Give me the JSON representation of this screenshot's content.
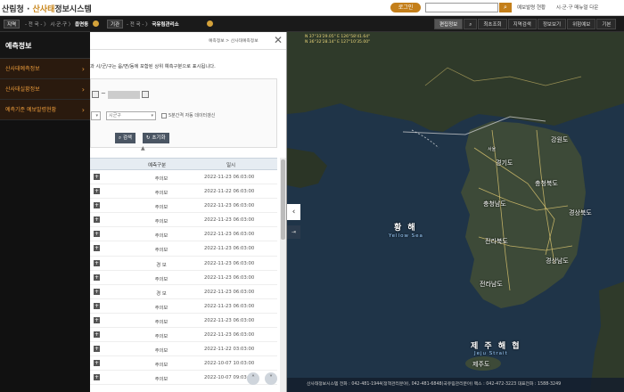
{
  "header": {
    "logo_pre": "산림청",
    "logo_accent": "산사태",
    "logo_post": "정보시스템",
    "login": "로그인",
    "links": [
      "예보발령 현황",
      "시·군·구 매뉴얼 다운"
    ]
  },
  "locbar": {
    "label1": "지역",
    "path1": "- 전 국 - 〉 시·군·구 〉",
    "current1": "읍면동",
    "label2": "기관",
    "path2": "- 전 국 - 〉",
    "current2": "국유림관리소",
    "tools": [
      "편집정보",
      "최초조회",
      "지역검색",
      "정보보기",
      "위험예보",
      "기본"
    ]
  },
  "leftnav": {
    "title": "예측정보",
    "items": [
      "산사태예측정보",
      "산사태실황정보",
      "예측기준 예보발령현황"
    ]
  },
  "panel": {
    "breadcrumb": "예측정보 > 산사태예측정보",
    "description": "과 시/군/구는 읍/면/동에 포함된 상위 예측구분으로 표시됩니다.",
    "select_city": "시군구",
    "checkbox_label": "5분간격 자동 데이터갱신",
    "search_btn": "검색",
    "reset_btn": "초기화",
    "col_type": "예측구분",
    "col_time": "일시",
    "rows": [
      {
        "type": "주의보",
        "time": "2022-11-23 06:03:00"
      },
      {
        "type": "주의보",
        "time": "2022-11-22 06:03:00"
      },
      {
        "type": "주의보",
        "time": "2022-11-23 06:03:00"
      },
      {
        "type": "주의보",
        "time": "2022-11-23 06:03:00"
      },
      {
        "type": "주의보",
        "time": "2022-11-23 06:03:00"
      },
      {
        "type": "주의보",
        "time": "2022-11-23 06:03:00"
      },
      {
        "type": "경 보",
        "time": "2022-11-23 06:03:00"
      },
      {
        "type": "주의보",
        "time": "2022-11-23 06:03:00"
      },
      {
        "type": "경 보",
        "time": "2022-11-23 06:03:00"
      },
      {
        "type": "주의보",
        "time": "2022-11-23 06:03:00"
      },
      {
        "type": "주의보",
        "time": "2022-11-23 06:03:00"
      },
      {
        "type": "주의보",
        "time": "2022-11-23 06:03:00"
      },
      {
        "type": "주의보",
        "time": "2022-11-22 03:03:00"
      },
      {
        "type": "주의보",
        "time": "2022-10-07 10:03:00"
      },
      {
        "type": "주의보",
        "time": "2022-10-07 09:03:00"
      }
    ]
  },
  "map": {
    "coords1": "N 37°33'29.05\" E 126°58'41.64\"",
    "coords2": "N 36°32'28.14\" E 127°10'35.00\"",
    "sea_ko": "황 해",
    "sea_en": "Yellow Sea",
    "strait_ko": "제 주 해 협",
    "strait_en": "Jeju Strait",
    "regions": [
      "강원도",
      "경기도",
      "서울",
      "충청북도",
      "충청남도",
      "경상북도",
      "전라북도",
      "경상남도",
      "전라남도",
      "제주도"
    ],
    "footer": "산사태정보시스템 전화 : 042-481-1944(정책관리분야), 042-481-6848(국유림관리분야) 팩스 : 042-472-3223 대표전화 : 1588-3249"
  }
}
